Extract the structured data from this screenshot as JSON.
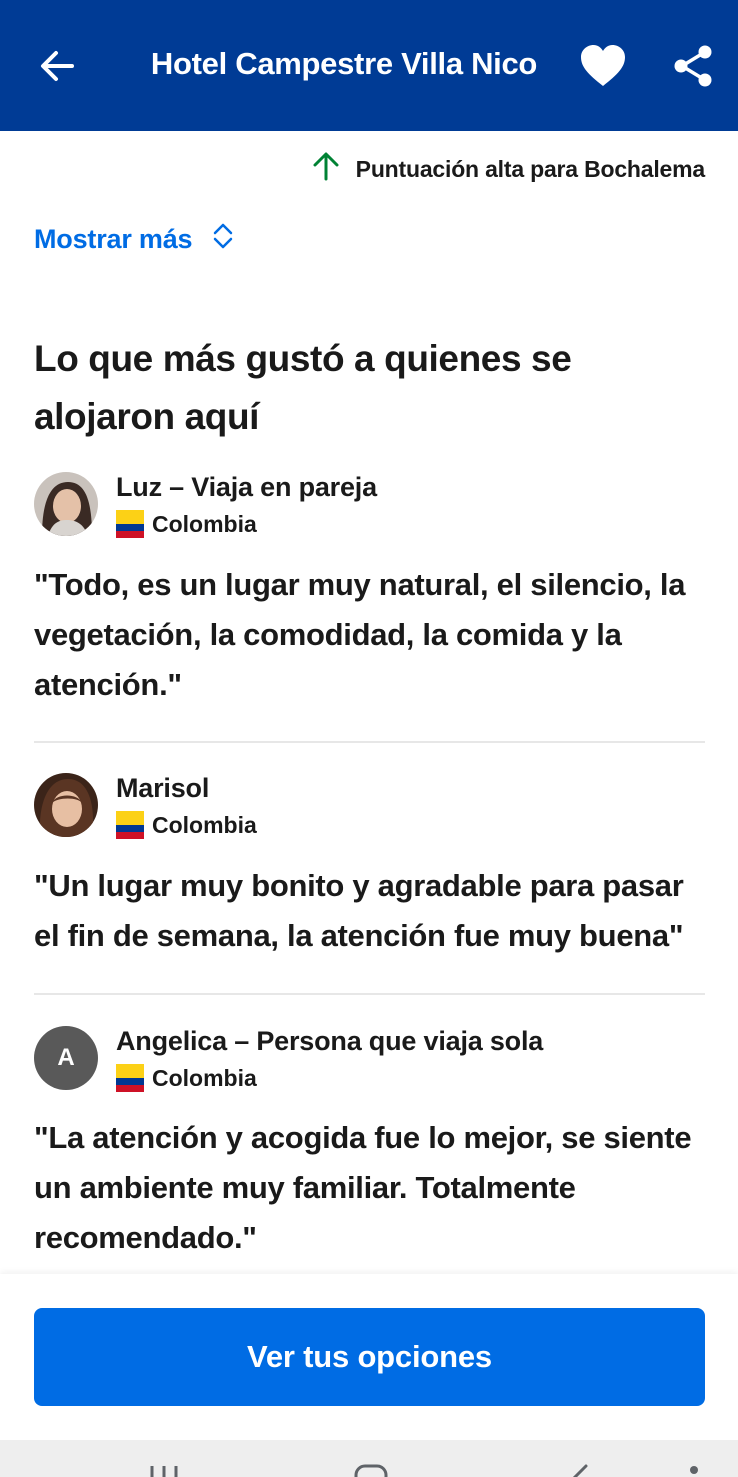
{
  "header": {
    "title": "Hotel Campestre Villa Nico",
    "back_icon": "arrow-left-icon",
    "favorite_icon": "heart-icon",
    "share_icon": "share-icon"
  },
  "score_note": {
    "text": "Puntuación alta para Bochalema",
    "icon": "arrow-up-icon",
    "icon_color": "#008234"
  },
  "show_more": {
    "label": "Mostrar más",
    "icon": "chevron-up-down-icon"
  },
  "section": {
    "title": "Lo que más gustó a quienes se alojaron aquí"
  },
  "reviews": [
    {
      "name": "Luz – Viaja en pareja",
      "country": "Colombia",
      "quote": "\"Todo, es un lugar muy natural, el silencio, la vegetación, la comodidad, la comida y la atención.\""
    },
    {
      "name": "Marisol",
      "country": "Colombia",
      "quote": "\"Un lugar muy bonito y agradable para pasar el fin de semana, la atención fue muy buena\""
    },
    {
      "name": "Angelica – Persona que viaja sola",
      "country": "Colombia",
      "avatar_letter": "A",
      "quote": "\"La atención y acogida fue lo mejor, se siente un ambiente muy familiar. Totalmente recomendado.\""
    }
  ],
  "cta": {
    "label": "Ver tus opciones"
  },
  "colors": {
    "header_bg": "#003b95",
    "link": "#006ce4",
    "button": "#006ce4"
  }
}
